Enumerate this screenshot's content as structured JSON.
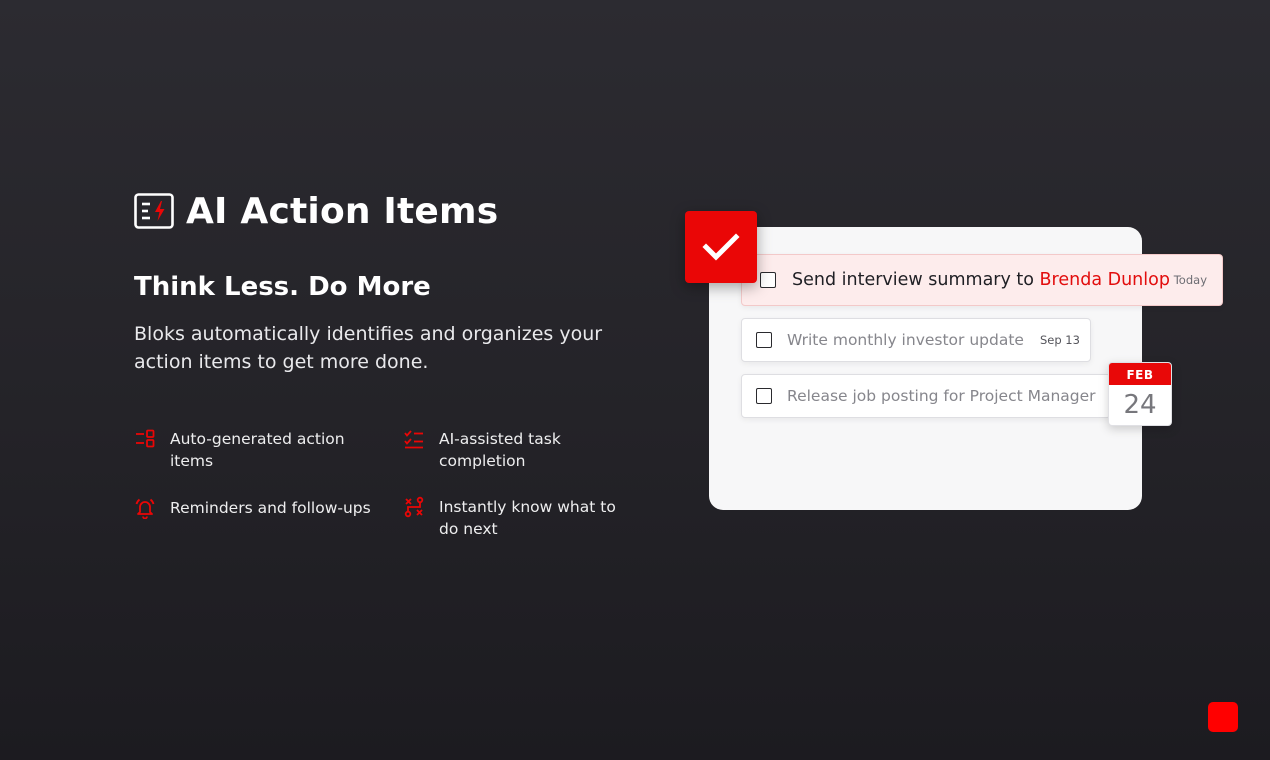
{
  "hero": {
    "title": "AI Action Items",
    "title_icon": "list-lightning-icon",
    "subtitle": "Think Less. Do More",
    "description": "Bloks automatically identifies and organizes your action items to  get more done."
  },
  "features": [
    {
      "icon": "auto-list-icon",
      "label": "Auto-generated action items"
    },
    {
      "icon": "checklist-icon",
      "label": "AI-assisted task completion"
    },
    {
      "icon": "alarm-bell-icon",
      "label": "Reminders and follow-ups"
    },
    {
      "icon": "route-icon",
      "label": "Instantly know what to do next"
    }
  ],
  "tasks": [
    {
      "text": "Send interview summary to ",
      "highlight": "Brenda Dunlop",
      "date": "Today",
      "checked": false
    },
    {
      "text": "Write monthly investor update",
      "date": "Sep 13",
      "checked": false
    },
    {
      "text": "Release job posting for Project Manager",
      "checked": false
    }
  ],
  "calendar": {
    "month": "FEB",
    "day": "24"
  },
  "colors": {
    "accent": "#ea0606",
    "background": "#26252a",
    "panel": "#f7f7f8",
    "highlight_row": "#fdecec"
  }
}
